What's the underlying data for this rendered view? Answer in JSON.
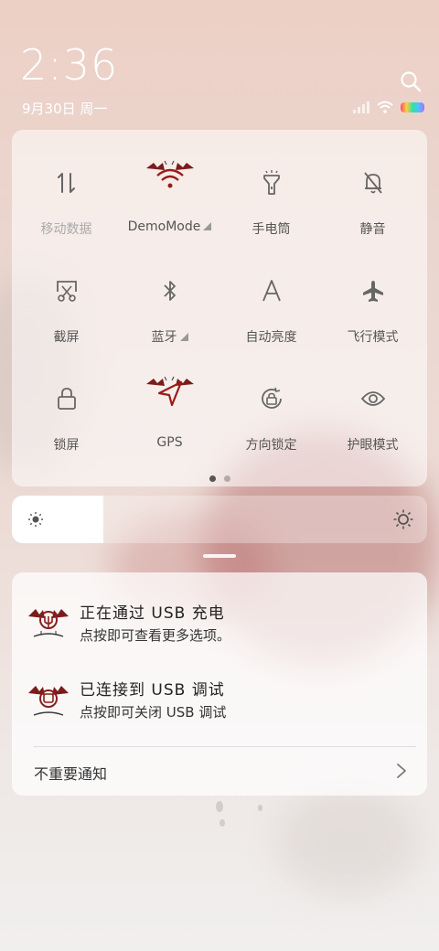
{
  "status": {
    "time": "2:36",
    "date": "9月30日 周一"
  },
  "colors": {
    "accent_red": "#8b1e1e",
    "text": "#555555",
    "dim": "#aaaaaa"
  },
  "toggles": [
    {
      "label": "移动数据",
      "icon": "data-arrows-icon",
      "dim": true,
      "dropdown": false
    },
    {
      "label": "DemoMode",
      "icon": "bat-wifi-icon",
      "dim": false,
      "dropdown": true
    },
    {
      "label": "手电筒",
      "icon": "flashlight-icon",
      "dim": false,
      "dropdown": false
    },
    {
      "label": "静音",
      "icon": "bell-off-icon",
      "dim": false,
      "dropdown": false
    },
    {
      "label": "截屏",
      "icon": "screenshot-icon",
      "dim": false,
      "dropdown": false
    },
    {
      "label": "蓝牙",
      "icon": "bluetooth-icon",
      "dim": false,
      "dropdown": true
    },
    {
      "label": "自动亮度",
      "icon": "auto-brightness-icon",
      "dim": false,
      "dropdown": false
    },
    {
      "label": "飞行模式",
      "icon": "airplane-icon",
      "dim": false,
      "dropdown": false
    },
    {
      "label": "锁屏",
      "icon": "lock-icon",
      "dim": false,
      "dropdown": false
    },
    {
      "label": "GPS",
      "icon": "bat-gps-icon",
      "dim": false,
      "dropdown": false
    },
    {
      "label": "方向锁定",
      "icon": "rotation-lock-icon",
      "dim": false,
      "dropdown": false
    },
    {
      "label": "护眼模式",
      "icon": "eye-icon",
      "dim": false,
      "dropdown": false
    }
  ],
  "pager": {
    "pages": 2,
    "current": 1
  },
  "brightness": {
    "level": 0.22
  },
  "notifications": [
    {
      "title": "正在通过 USB 充电",
      "subtitle": "点按即可查看更多选项。"
    },
    {
      "title": "已连接到 USB 调试",
      "subtitle": "点按即可关闭 USB 调试"
    }
  ],
  "minor_notifications_label": "不重要通知"
}
